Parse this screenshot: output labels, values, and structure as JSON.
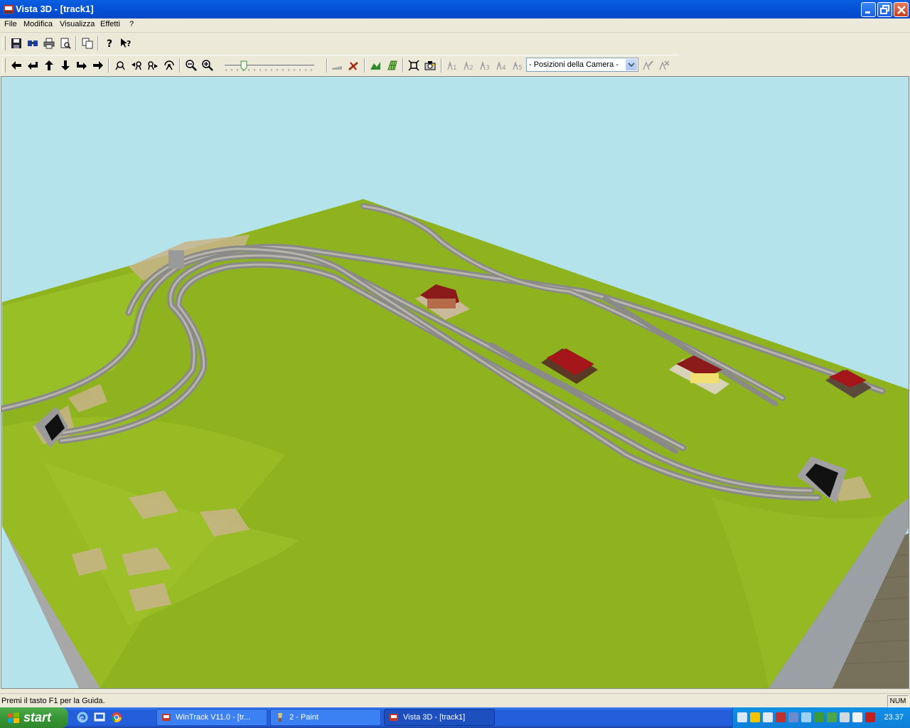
{
  "window": {
    "title": "Vista 3D - [track1]",
    "controls": [
      "minimize-icon",
      "restore-icon",
      "close-icon"
    ]
  },
  "menu": [
    "File",
    "Modifica",
    "Visualizza",
    "Effetti",
    "?"
  ],
  "toolbar1": {
    "icons": [
      "save-icon",
      "3d-view-icon",
      "print-icon",
      "print-preview-icon",
      "copy-icon",
      "help-icon",
      "context-help-icon"
    ]
  },
  "toolbar2": {
    "nav_icons": [
      "arrow-left-icon",
      "turn-left-icon",
      "arrow-up-icon",
      "arrow-down-icon",
      "turn-right-icon",
      "arrow-right-icon"
    ],
    "camera_icons": [
      "camera-tilt-up-icon",
      "camera-tilt-left-icon",
      "camera-tilt-right-icon",
      "camera-tilt-down-icon"
    ],
    "zoom_icons": [
      "zoom-out-icon",
      "zoom-in-icon"
    ],
    "camera_positions": [
      "1",
      "2",
      "3",
      "4",
      "5"
    ],
    "camera_combo": "- Posizioni della Camera -"
  },
  "statusbar": {
    "message": "Premi il tasto F1 per la Guida.",
    "num": "NUM"
  },
  "taskbar": {
    "start": "start",
    "tasks": [
      {
        "label": "WinTrack  V11.0 - [tr...",
        "active": false
      },
      {
        "label": "2 - Paint",
        "active": false
      },
      {
        "label": "Vista 3D - [track1]",
        "active": true
      }
    ],
    "clock": "23.37"
  },
  "colors": {
    "sky": "#b5e3ec",
    "grass": "#8fb31f",
    "floor": "#77705a",
    "titlebar": "#0553d8",
    "building_roof": "#8b1a1a"
  }
}
